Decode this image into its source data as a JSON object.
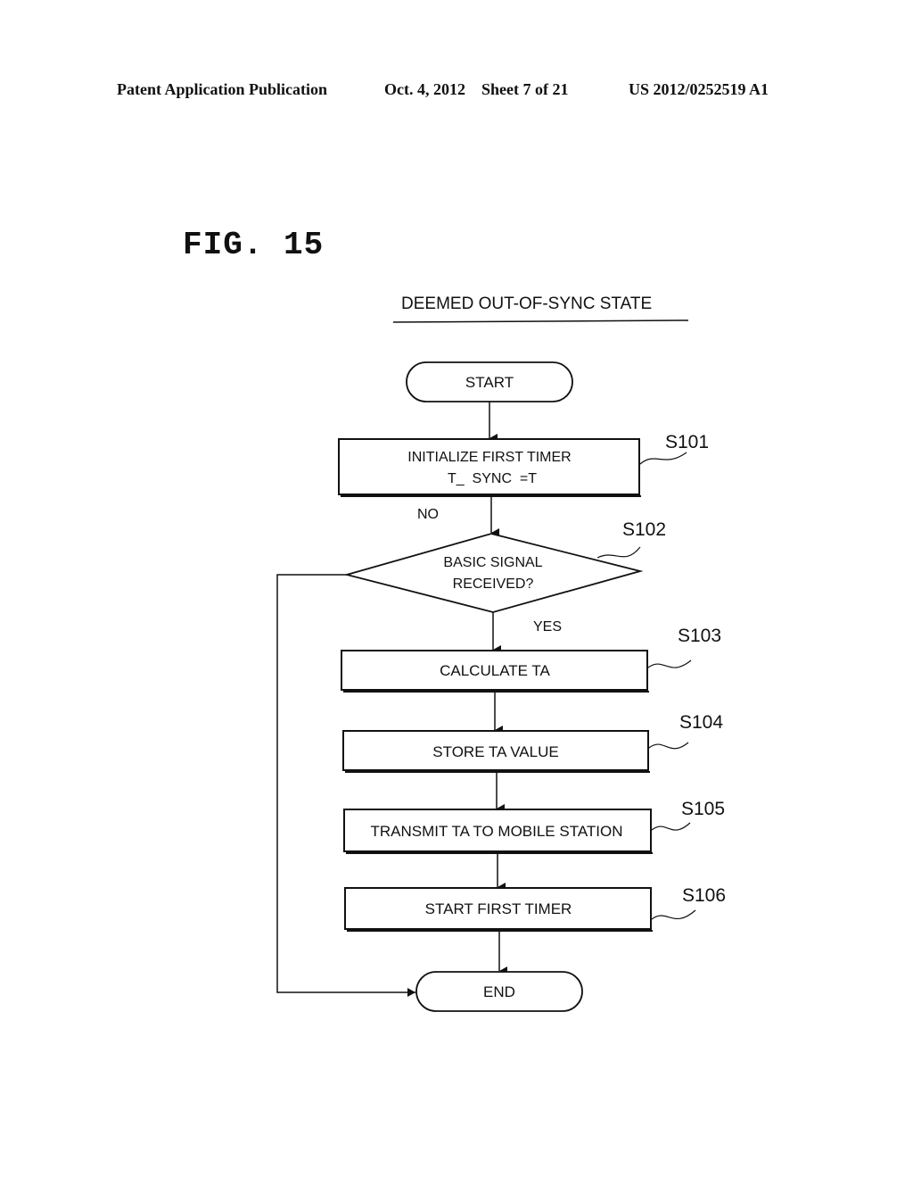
{
  "header": {
    "publication": "Patent Application Publication",
    "date_sheet": "Oct. 4, 2012    Sheet 7 of 21",
    "number": "US 2012/0252519 A1"
  },
  "figure": {
    "label": "FIG. 15",
    "title": "DEEMED OUT-OF-SYNC STATE"
  },
  "flowchart": {
    "start": "START",
    "end": "END",
    "steps": [
      {
        "id": "S101",
        "lines": [
          "INITIALIZE FIRST TIMER",
          "T_  SYNC  =T"
        ]
      },
      {
        "id": "S102",
        "lines": [
          "BASIC SIGNAL",
          "RECEIVED?"
        ]
      },
      {
        "id": "S103",
        "lines": [
          "CALCULATE TA"
        ]
      },
      {
        "id": "S104",
        "lines": [
          "STORE TA VALUE"
        ]
      },
      {
        "id": "S105",
        "lines": [
          "TRANSMIT TA TO MOBILE STATION"
        ]
      },
      {
        "id": "S106",
        "lines": [
          "START FIRST TIMER"
        ]
      }
    ],
    "no_label": "NO",
    "yes_label": "YES"
  }
}
